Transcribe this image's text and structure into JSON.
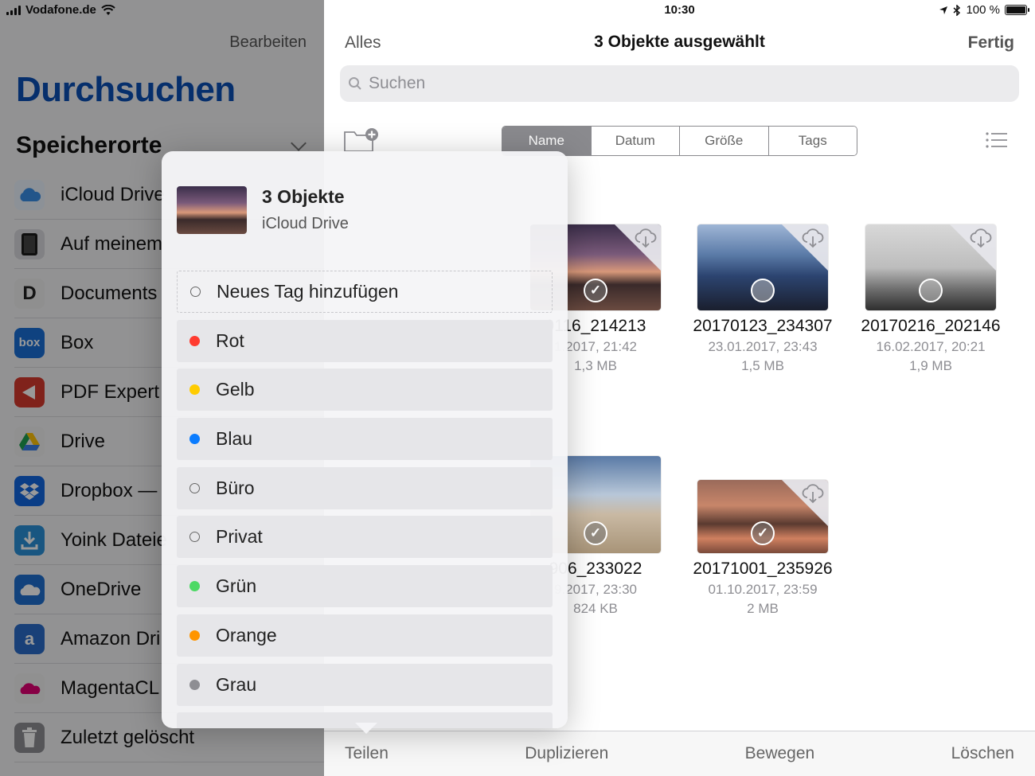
{
  "status": {
    "carrier": "Vodafone.de",
    "time": "10:30",
    "battery": "100 %",
    "battery_level": 1.0
  },
  "sidebar": {
    "edit_label": "Bearbeiten",
    "title": "Durchsuchen",
    "section_title": "Speicherorte",
    "items": [
      {
        "label": "iCloud Drive",
        "icon": "icloud-icon",
        "color": "#3a8ee6"
      },
      {
        "label": "Auf meinem",
        "icon": "ipad-icon",
        "color": "#2a2a2a"
      },
      {
        "label": "Documents",
        "icon": "documents-icon",
        "color": "#e8e8e8"
      },
      {
        "label": "Box",
        "icon": "box-icon",
        "color": "#1a6fd6"
      },
      {
        "label": "PDF Expert",
        "icon": "pdf-expert-icon",
        "color": "#d63a2e"
      },
      {
        "label": "Drive",
        "icon": "google-drive-icon",
        "color": "#f0f0f0"
      },
      {
        "label": "Dropbox —",
        "icon": "dropbox-icon",
        "color": "#1266e0"
      },
      {
        "label": "Yoink Dateie",
        "icon": "yoink-icon",
        "color": "#2b8fd8"
      },
      {
        "label": "OneDrive",
        "icon": "onedrive-icon",
        "color": "#1e6fcf"
      },
      {
        "label": "Amazon Dri",
        "icon": "amazon-drive-icon",
        "color": "#2a6cc8"
      },
      {
        "label": "MagentaCL",
        "icon": "magentacloud-icon",
        "color": "#f0f0f0"
      },
      {
        "label": "Zuletzt gelöscht",
        "icon": "trash-icon",
        "color": "#8e8e93"
      }
    ]
  },
  "nav": {
    "left": "Alles",
    "title": "3 Objekte ausgewählt",
    "right": "Fertig"
  },
  "search": {
    "placeholder": "Suchen"
  },
  "sort": {
    "options": [
      "Name",
      "Datum",
      "Größe",
      "Tags"
    ],
    "active": "Name"
  },
  "files": [
    {
      "name": "0116_214213",
      "date": "1.2017, 21:42",
      "size": "1,3 MB",
      "selected": true
    },
    {
      "name": "20170123_234307",
      "date": "23.01.2017, 23:43",
      "size": "1,5 MB",
      "selected": false
    },
    {
      "name": "20170216_202146",
      "date": "16.02.2017, 20:21",
      "size": "1,9 MB",
      "selected": false
    },
    {
      "name": "906_233022",
      "date": "9.2017, 23:30",
      "size": "824 KB",
      "selected": true
    },
    {
      "name": "20171001_235926",
      "date": "01.10.2017, 23:59",
      "size": "2 MB",
      "selected": true
    }
  ],
  "toolbar": {
    "share": "Teilen",
    "duplicate": "Duplizieren",
    "move": "Bewegen",
    "delete": "Löschen"
  },
  "popover": {
    "title": "3 Objekte",
    "subtitle": "iCloud Drive",
    "tags": [
      {
        "label": "Neues Tag hinzufügen",
        "color": "",
        "type": "new"
      },
      {
        "label": "Rot",
        "color": "#ff3b30",
        "type": "color"
      },
      {
        "label": "Gelb",
        "color": "#ffcc00",
        "type": "color"
      },
      {
        "label": "Blau",
        "color": "#0a7cff",
        "type": "color"
      },
      {
        "label": "Büro",
        "color": "",
        "type": "hollow"
      },
      {
        "label": "Privat",
        "color": "",
        "type": "hollow"
      },
      {
        "label": "Grün",
        "color": "#4cd964",
        "type": "color"
      },
      {
        "label": "Orange",
        "color": "#ff9500",
        "type": "color"
      },
      {
        "label": "Grau",
        "color": "#8e8e93",
        "type": "color"
      }
    ]
  }
}
